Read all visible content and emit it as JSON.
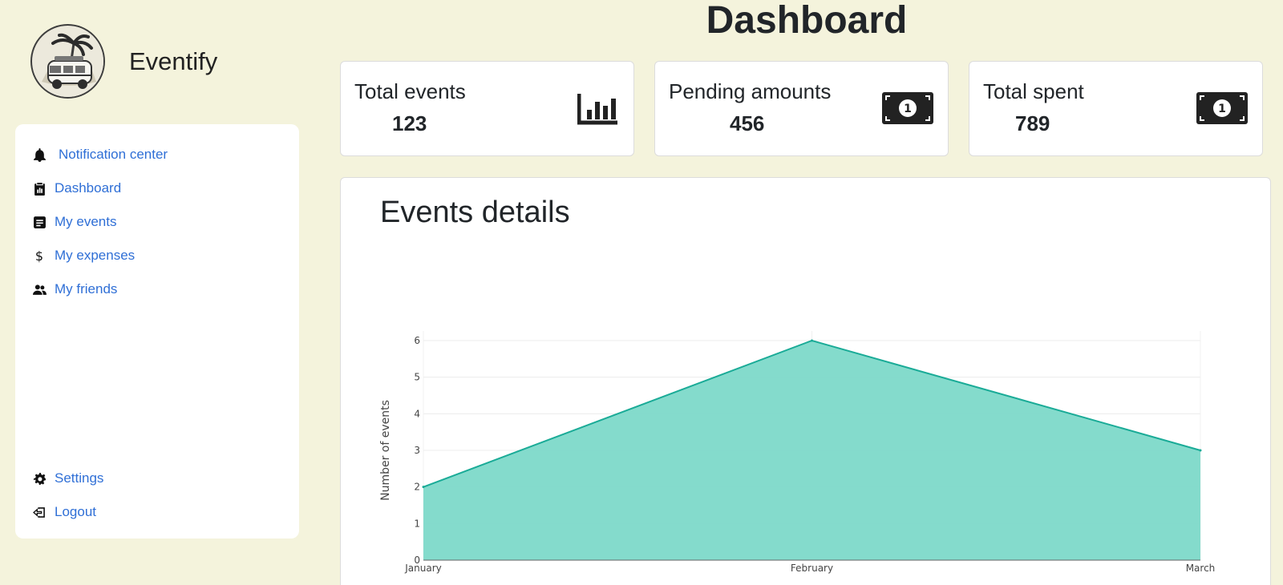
{
  "app": {
    "name": "Eventify"
  },
  "sidebar": {
    "items": [
      {
        "label": "Notification center",
        "icon": "bell-icon"
      },
      {
        "label": "Dashboard",
        "icon": "clipboard-chart-icon"
      },
      {
        "label": "My events",
        "icon": "list-card-icon"
      },
      {
        "label": "My expenses",
        "icon": "dollar-icon"
      },
      {
        "label": "My friends",
        "icon": "people-icon"
      }
    ],
    "bottom_items": [
      {
        "label": "Settings",
        "icon": "gear-icon"
      },
      {
        "label": "Logout",
        "icon": "logout-icon"
      }
    ]
  },
  "header": {
    "title": "Dashboard"
  },
  "stats": [
    {
      "label": "Total events",
      "value": "123",
      "icon": "bar-chart-icon"
    },
    {
      "label": "Pending amounts",
      "value": "456",
      "icon": "banknote-icon"
    },
    {
      "label": "Total spent",
      "value": "789",
      "icon": "banknote-icon"
    }
  ],
  "chart_data": {
    "type": "area",
    "title": "Events details",
    "categories": [
      "January",
      "February",
      "March"
    ],
    "series": [
      {
        "values": [
          2,
          6,
          3
        ]
      }
    ],
    "xlabel": "",
    "ylabel": "Number of events",
    "ylim": [
      0,
      6
    ],
    "yticks": [
      0,
      1,
      2,
      3,
      4,
      5,
      6
    ],
    "grid": true,
    "fill_color": "#7dd9c9",
    "line_color": "#1aab97"
  },
  "colors": {
    "background": "#f4f3dc",
    "link": "#2f6fd6"
  }
}
